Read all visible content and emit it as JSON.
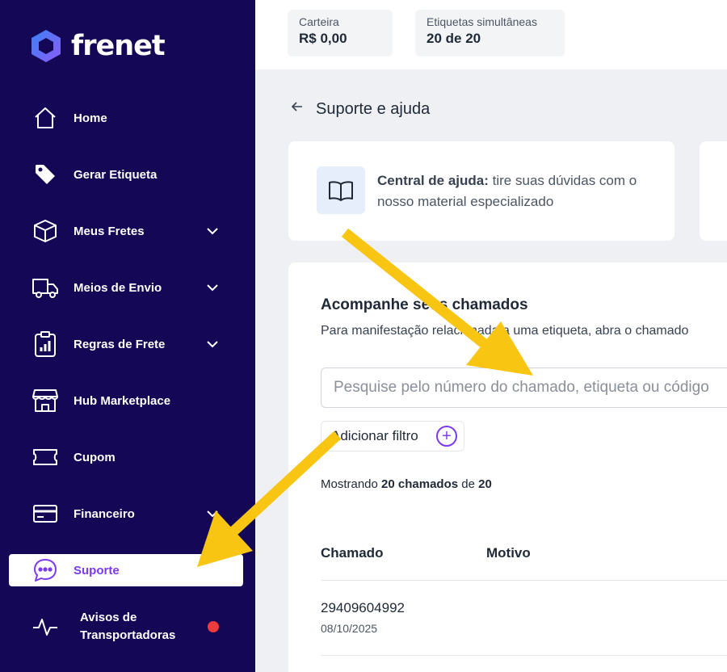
{
  "brand": {
    "name": "frenet"
  },
  "sidebar": {
    "items": [
      {
        "label": "Home",
        "icon": "home-icon"
      },
      {
        "label": "Gerar Etiqueta",
        "icon": "tag-icon"
      },
      {
        "label": "Meus Fretes",
        "icon": "box-icon",
        "expandable": true
      },
      {
        "label": "Meios de Envio",
        "icon": "truck-icon",
        "expandable": true
      },
      {
        "label": "Regras de Frete",
        "icon": "clipboard-chart-icon",
        "expandable": true
      },
      {
        "label": "Hub Marketplace",
        "icon": "store-icon"
      },
      {
        "label": "Cupom",
        "icon": "ticket-icon"
      },
      {
        "label": "Financeiro",
        "icon": "credit-card-icon",
        "expandable": true
      },
      {
        "label": "Suporte",
        "icon": "chat-icon",
        "active": true
      },
      {
        "label_line1": "Avisos de",
        "label_line2": "Transportadoras",
        "icon": "activity-icon",
        "notification": true
      }
    ]
  },
  "topbar": {
    "wallet": {
      "label": "Carteira",
      "value": "R$ 0,00"
    },
    "labels": {
      "label": "Etiquetas simultâneas",
      "value": "20 de 20"
    }
  },
  "page": {
    "back_icon": "arrow-left-icon",
    "title": "Suporte e ajuda"
  },
  "help_card": {
    "icon": "book-icon",
    "title": "Central de ajuda:",
    "text": " tire suas dúvidas com o nosso material especializado"
  },
  "tickets": {
    "title": "Acompanhe seus chamados",
    "description": "Para manifestação relacionada a uma etiqueta, abra o chamado",
    "search_placeholder": "Pesquise pelo número do chamado, etiqueta ou código",
    "filter_label": "Adicionar filtro",
    "showing_prefix": "Mostrando ",
    "showing_count": "20 chamados",
    "showing_mid": " de ",
    "showing_total": "20",
    "columns": [
      "Chamado",
      "Motivo"
    ],
    "rows": [
      {
        "id": "29409604992",
        "date": "08/10/2025"
      }
    ]
  },
  "colors": {
    "sidebar_bg": "#140755",
    "accent": "#7c3aed",
    "arrow": "#f7c512",
    "notification": "#f23b3b"
  }
}
